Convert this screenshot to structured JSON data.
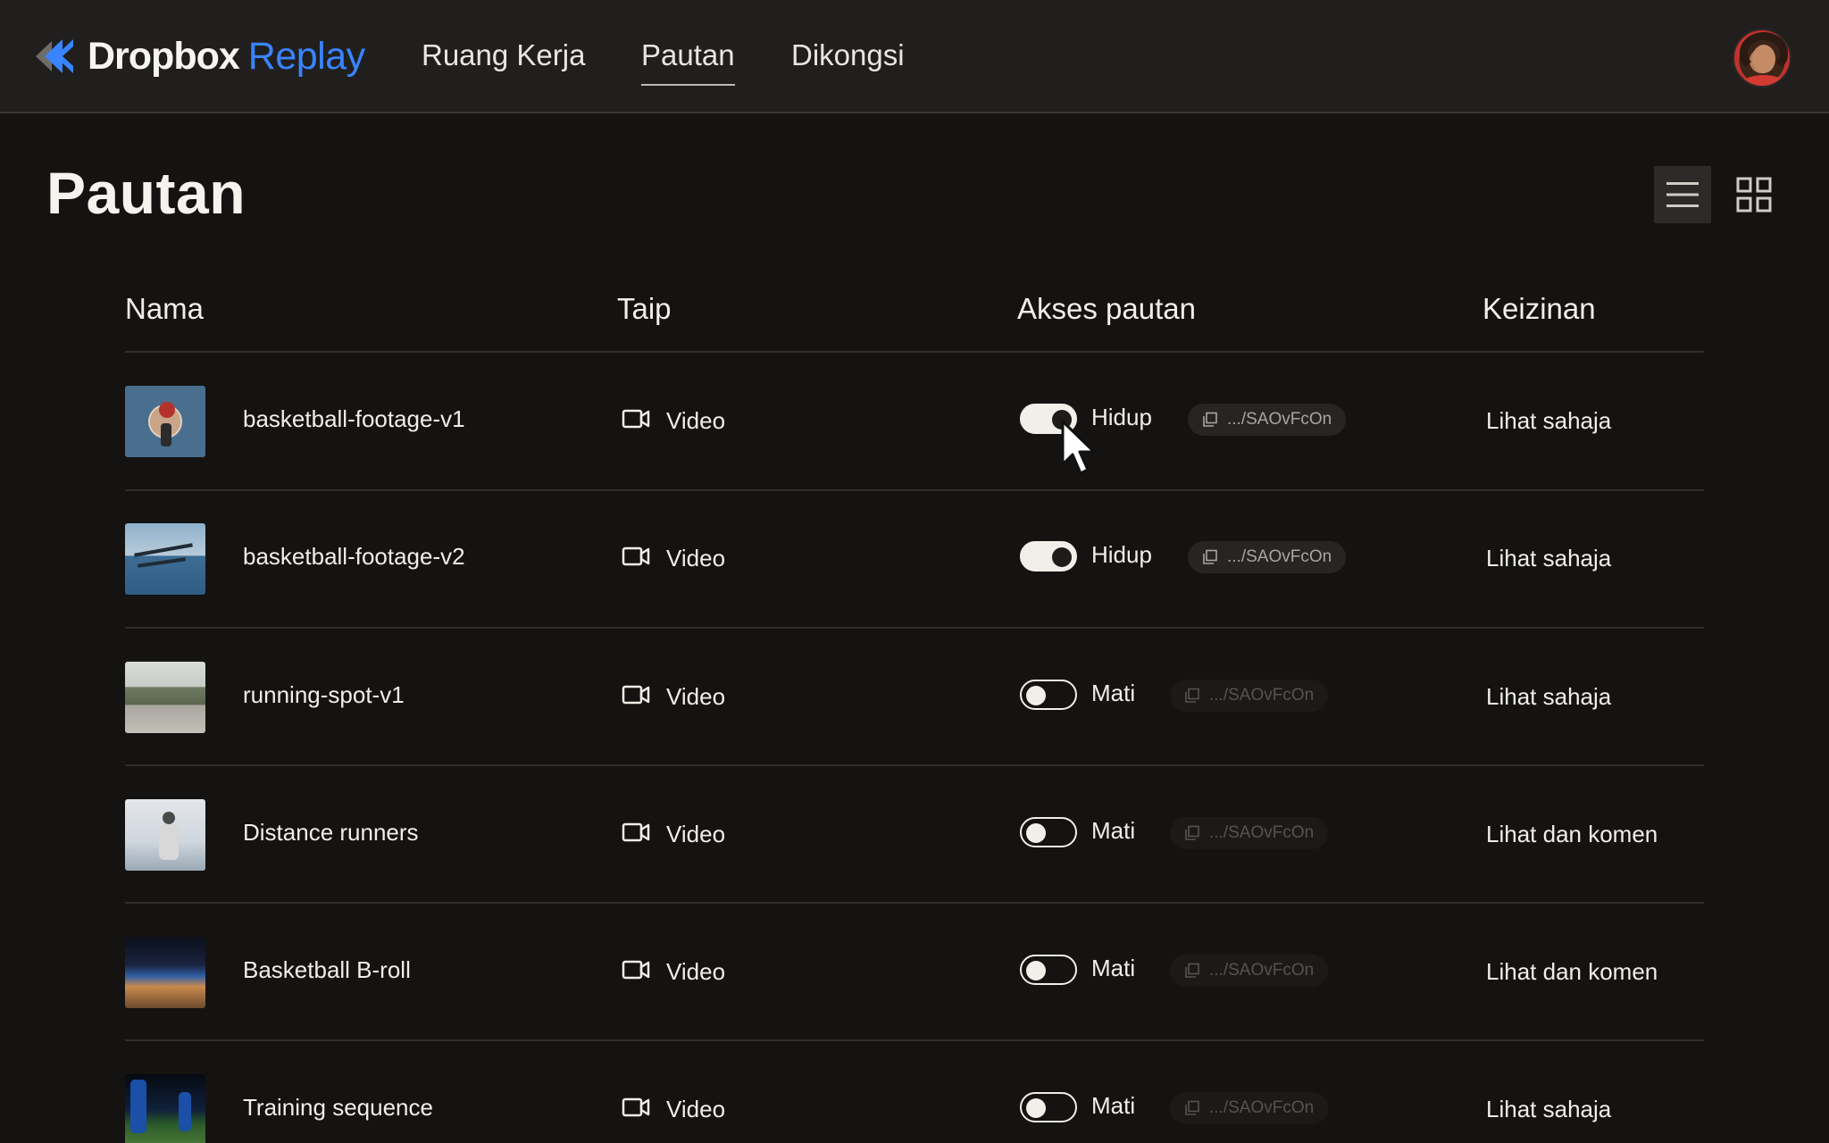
{
  "app": {
    "brand_main": "Dropbox",
    "brand_sub": "Replay",
    "brand_color": "#3984ff"
  },
  "nav": {
    "tabs": [
      {
        "label": "Ruang Kerja",
        "active": false
      },
      {
        "label": "Pautan",
        "active": true
      },
      {
        "label": "Dikongsi",
        "active": false
      }
    ]
  },
  "page": {
    "title": "Pautan",
    "view_modes": [
      "list-view-icon",
      "grid-view-icon"
    ],
    "active_view": "list"
  },
  "table": {
    "headers": {
      "name": "Nama",
      "type": "Taip",
      "access": "Akses pautan",
      "permission": "Keizinan"
    },
    "rows": [
      {
        "name": "basketball-footage-v1",
        "type": "Video",
        "access_on": true,
        "access_label": "Hidup",
        "link": ".../SAOvFcOn",
        "permission": "Lihat sahaja"
      },
      {
        "name": "basketball-footage-v2",
        "type": "Video",
        "access_on": true,
        "access_label": "Hidup",
        "link": ".../SAOvFcOn",
        "permission": "Lihat sahaja"
      },
      {
        "name": "running-spot-v1",
        "type": "Video",
        "access_on": false,
        "access_label": "Mati",
        "link": ".../SAOvFcOn",
        "permission": "Lihat sahaja"
      },
      {
        "name": "Distance runners",
        "type": "Video",
        "access_on": false,
        "access_label": "Mati",
        "link": ".../SAOvFcOn",
        "permission": "Lihat dan komen"
      },
      {
        "name": "Basketball B-roll",
        "type": "Video",
        "access_on": false,
        "access_label": "Mati",
        "link": ".../SAOvFcOn",
        "permission": "Lihat dan komen"
      },
      {
        "name": "Training sequence",
        "type": "Video",
        "access_on": false,
        "access_label": "Mati",
        "link": ".../SAOvFcOn",
        "permission": "Lihat sahaja"
      }
    ]
  }
}
